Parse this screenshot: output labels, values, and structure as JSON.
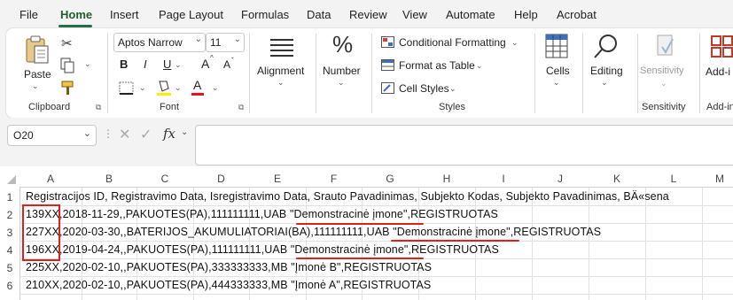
{
  "menu": [
    "File",
    "Home",
    "Insert",
    "Page Layout",
    "Formulas",
    "Data",
    "Review",
    "View",
    "Automate",
    "Help",
    "Acrobat"
  ],
  "ribbon": {
    "clipboard": {
      "paste": "Paste",
      "label": "Clipboard"
    },
    "font": {
      "name": "Aptos Narrow",
      "size": "11",
      "bold": "B",
      "italic": "I",
      "underline": "U",
      "grow": "A",
      "shrink": "A",
      "color_letter": "A",
      "label": "Font"
    },
    "alignment": {
      "label": "Alignment"
    },
    "number": {
      "symbol": "%",
      "label": "Number"
    },
    "styles": {
      "conditional": "Conditional Formatting",
      "table": "Format as Table",
      "cell": "Cell Styles",
      "label": "Styles"
    },
    "cells": {
      "label": "Cells"
    },
    "editing": {
      "label": "Editing"
    },
    "sensitivity": {
      "button": "Sensitivity",
      "label": "Sensitivity"
    },
    "addins": {
      "button": "Add-i",
      "label": "Add-in"
    }
  },
  "formula_bar": {
    "name_box": "O20",
    "fx": "fx",
    "value": ""
  },
  "columns": [
    "A",
    "B",
    "C",
    "D",
    "E",
    "F",
    "G",
    "H",
    "I",
    "J",
    "K",
    "L",
    "M"
  ],
  "rows": [
    {
      "num": "1",
      "text": "Registracijos ID, Registravimo Data, Isregistravimo Data, Srauto Pavadinimas, Subjekto Kodas, Subjekto Pavadinimas, BÄ«sena"
    },
    {
      "num": "2",
      "text": "139XX,2018-11-29,,PAKUOTES(PA),111111111,UAB \"Demonstracinė įmone\",REGISTRUOTAS"
    },
    {
      "num": "3",
      "text": "227XX,2020-03-30,,BATERIJOS_AKUMULIATORIAI(BA),111111111,UAB \"Demonstracinė įmone\",REGISTRUOTAS"
    },
    {
      "num": "4",
      "text": "196XX,2019-04-24,,PAKUOTES(PA),111111111,UAB \"Demonstracinė įmone\",REGISTRUOTAS"
    },
    {
      "num": "5",
      "text": "225XX,2020-02-10,,PAKUOTES(PA),333333333,MB \"Įmonė B\",REGISTRUOTAS"
    },
    {
      "num": "6",
      "text": "210XX,2020-02-10,,PAKUOTES(PA),444333333,MB \"Įmonė A\",REGISTRUOTAS"
    }
  ],
  "colors": {
    "accent": "#1e7145",
    "annotation": "#e0201b"
  }
}
